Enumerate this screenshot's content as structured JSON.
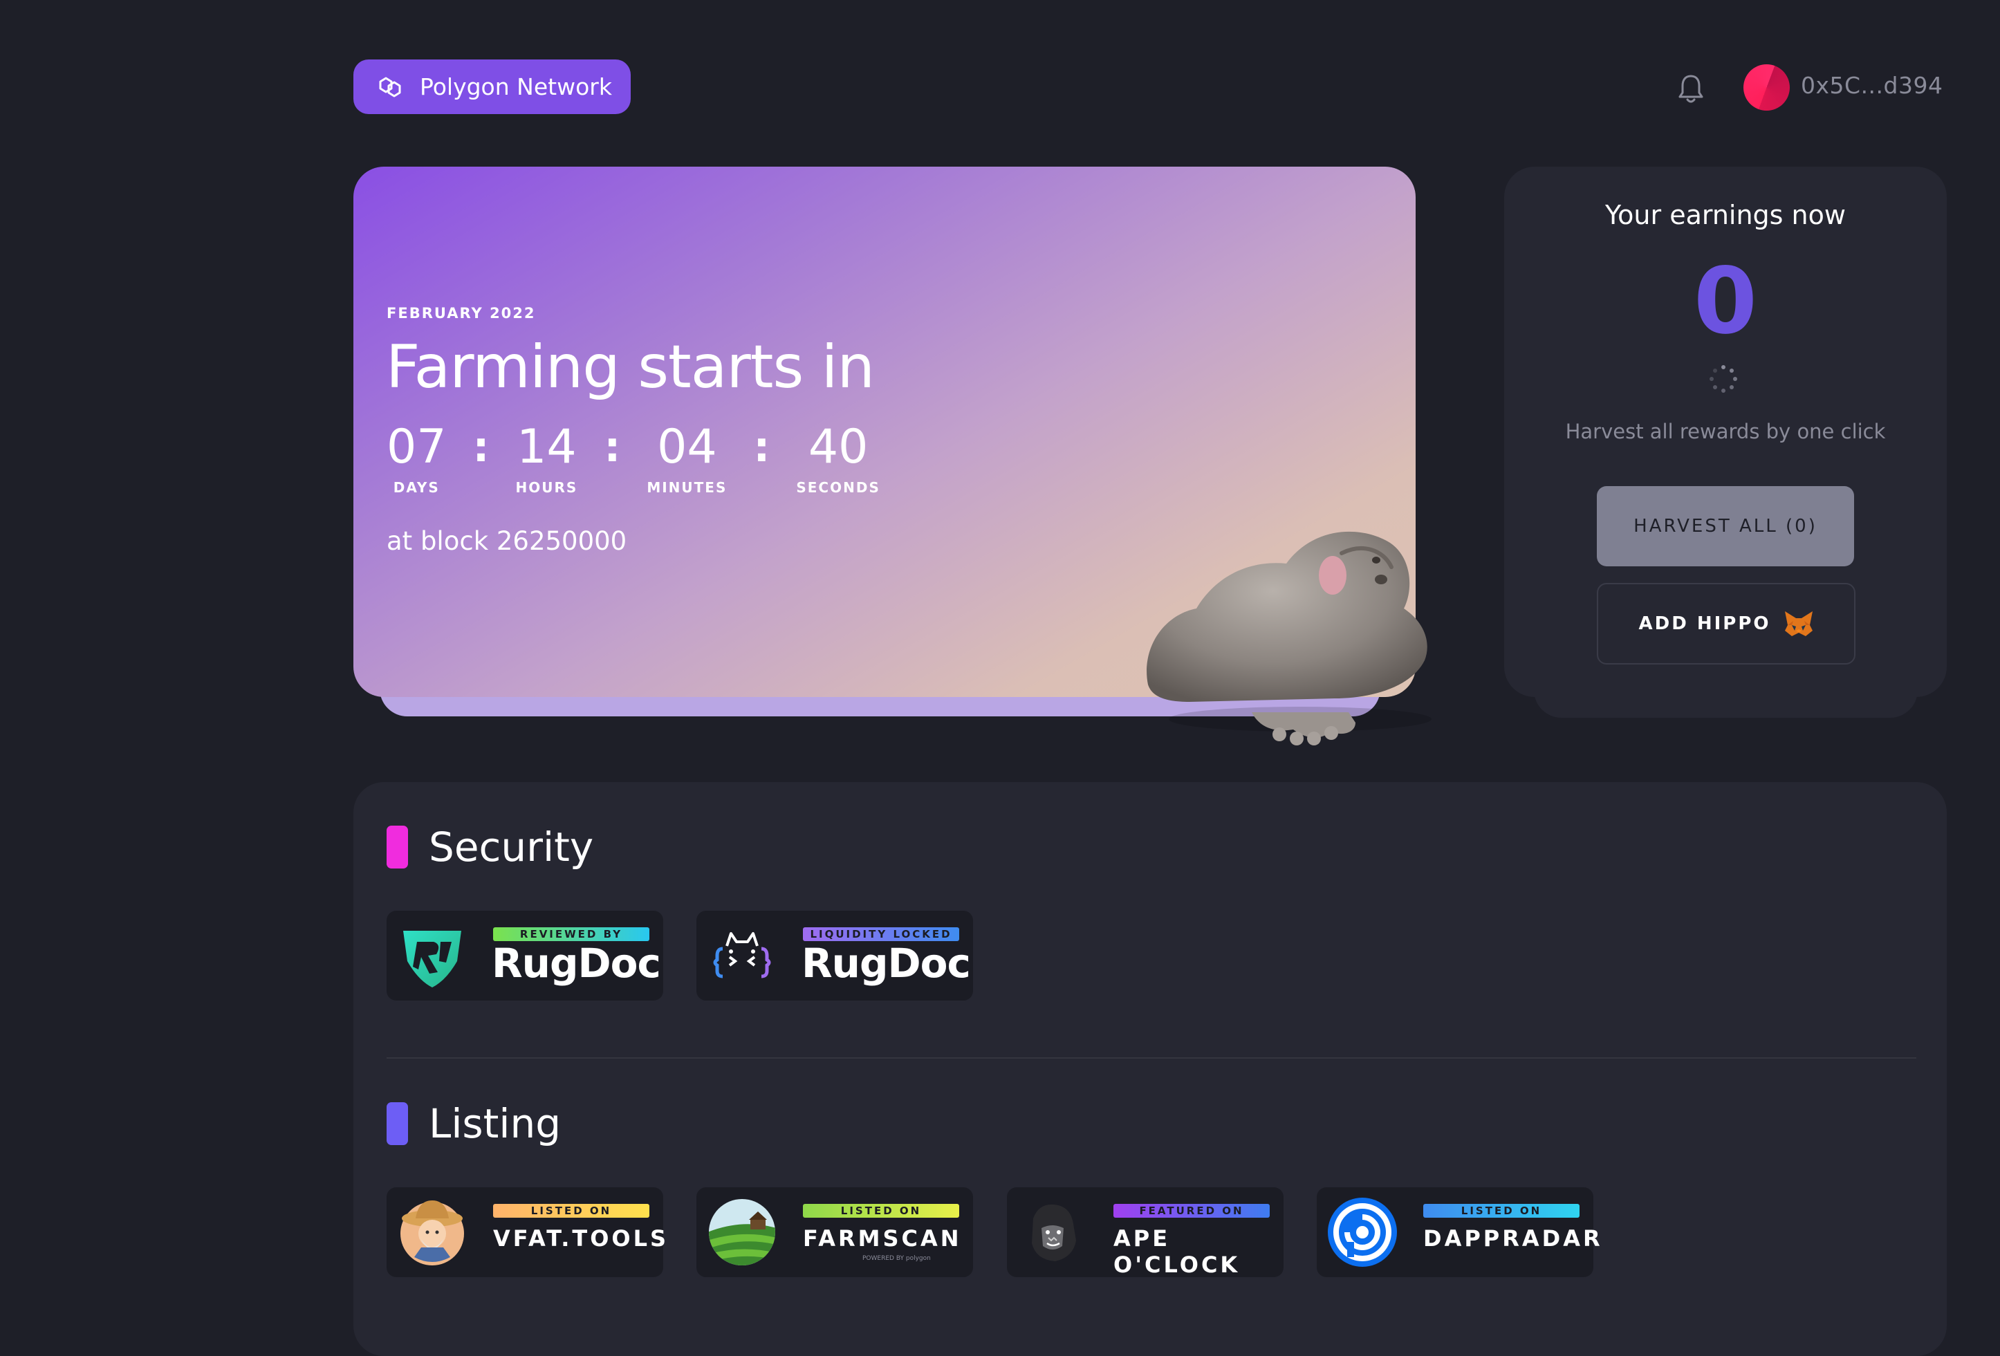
{
  "topbar": {
    "network_label": "Polygon Network",
    "wallet_address": "0x5C...d394"
  },
  "hero": {
    "date": "FEBRUARY 2022",
    "title": "Farming starts in",
    "countdown": [
      {
        "value": "07",
        "label": "DAYS"
      },
      {
        "value": "14",
        "label": "HOURS"
      },
      {
        "value": "04",
        "label": "MINUTES"
      },
      {
        "value": "40",
        "label": "SECONDS"
      }
    ],
    "separator": ":",
    "block_text": "at block 26250000"
  },
  "earnings": {
    "title": "Your earnings now",
    "amount": "0",
    "subtitle": "Harvest all rewards by one click",
    "harvest_label": "HARVEST ALL (0)",
    "add_label": "ADD HIPPO"
  },
  "security": {
    "title": "Security",
    "accent": "#f02cde",
    "badges": [
      {
        "tag": "REVIEWED BY",
        "name": "RugDoc",
        "tag_color": "#3fd4b4"
      },
      {
        "tag": "LIQUIDITY LOCKED",
        "name": "RugDoc",
        "tag_color": "#9f6cf0"
      }
    ]
  },
  "listing": {
    "title": "Listing",
    "accent": "#6d5ef5",
    "badges": [
      {
        "tag": "LISTED ON",
        "name": "VFAT.TOOLS",
        "tag_color": "#ffc94d"
      },
      {
        "tag": "LISTED ON",
        "name": "FARMSCAN",
        "tag_color": "#c6e84a",
        "powered": "POWERED BY polygon"
      },
      {
        "tag": "FEATURED ON",
        "name": "APE O'CLOCK",
        "tag_color": "#8b4cf0"
      },
      {
        "tag": "LISTED ON",
        "name": "DAPPRADAR",
        "tag_color": "#2ea3ff"
      }
    ]
  }
}
